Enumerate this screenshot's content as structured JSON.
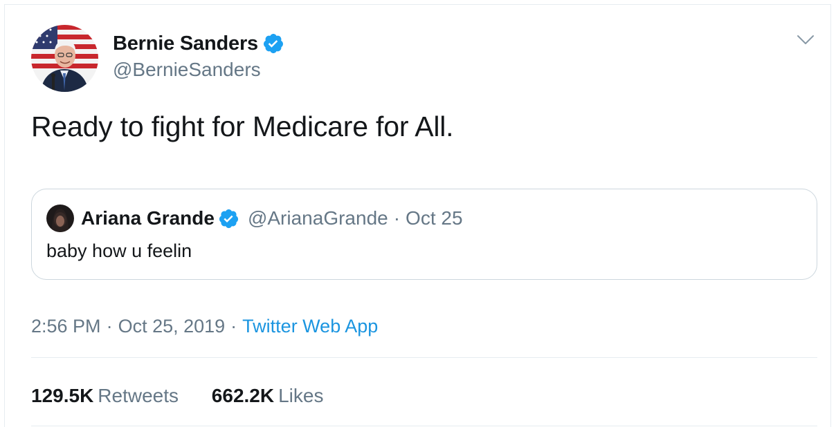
{
  "tweet": {
    "author": {
      "name": "Bernie Sanders",
      "handle": "@BernieSanders",
      "verified": true
    },
    "text": "Ready to fight for Medicare for All.",
    "quoted": {
      "author": {
        "name": "Ariana Grande",
        "handle": "@ArianaGrande",
        "verified": true
      },
      "separator": "·",
      "date": "Oct 25",
      "text": "baby how u feelin"
    },
    "meta": {
      "time": "2:56 PM",
      "separator": "·",
      "date": "Oct 25, 2019",
      "source": "Twitter Web App"
    },
    "stats": {
      "retweets_count": "129.5K",
      "retweets_label": "Retweets",
      "likes_count": "662.2K",
      "likes_label": "Likes"
    }
  },
  "icons": {
    "verified": "verified-badge-icon",
    "caret": "chevron-down-icon"
  },
  "colors": {
    "text_primary": "#14171a",
    "text_secondary": "#657786",
    "link": "#1b95e0",
    "verified": "#1da1f2",
    "border": "#ccd6dd",
    "divider": "#e6ecf0"
  }
}
